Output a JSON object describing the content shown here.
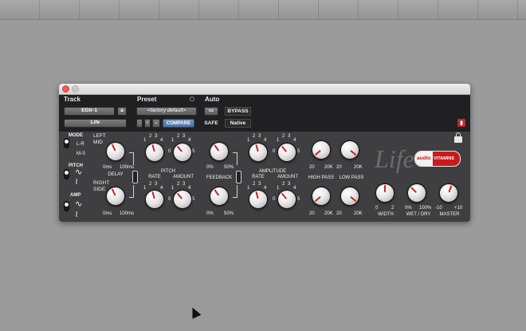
{
  "header": {
    "track_label": "Track",
    "preset_label": "Preset",
    "auto_label": "Auto",
    "track_name": "EGtr-1",
    "track_channel": "a",
    "insert_name": "Life",
    "preset_name": "<factory default>",
    "preset_minus": "-",
    "preset_plus": "+",
    "compare_label": "COMPARE",
    "bypass_label": "BYPASS",
    "safe_label": "SAFE",
    "native_label": "Native"
  },
  "plugin": {
    "brand_logo": "Life",
    "badge_left": "audio",
    "badge_right": "VITAMINS",
    "mode": {
      "label": "MODE",
      "opt_lr": "L-R",
      "opt_ms": "M-S"
    },
    "pitch_switch_label": "PITCH",
    "amp_switch_label": "AMP",
    "left_mid_line1": "LEFT",
    "left_mid_line2": "MID",
    "right_side_line1": "RIGHT",
    "right_side_line2": "SIDE",
    "delay": {
      "label": "DELAY",
      "min": "0ms",
      "max": "100ms"
    },
    "pitch": {
      "label": "PITCH",
      "rate_label": "RATE",
      "amount_label": "AMOUNT"
    },
    "feedback": {
      "label": "FEEDBACK",
      "min": "0%",
      "max": "50%"
    },
    "amplitude": {
      "label": "AMPLITUDE",
      "rate_label": "RATE",
      "amount_label": "AMOUNT"
    },
    "scale": [
      "0",
      "1",
      "2",
      "3",
      "4",
      "5"
    ],
    "high_pass": {
      "label": "HIGH PASS",
      "min": "20",
      "max": "20K"
    },
    "low_pass": {
      "label": "LOW PASS",
      "min": "20",
      "max": "20K"
    },
    "width": {
      "label": "WIDTH",
      "min": "0",
      "max": "2"
    },
    "wet_dry": {
      "label": "WET / DRY",
      "min": "0%",
      "max": "100%"
    },
    "master": {
      "label": "MASTER",
      "min": "-10",
      "max": "+10"
    }
  }
}
